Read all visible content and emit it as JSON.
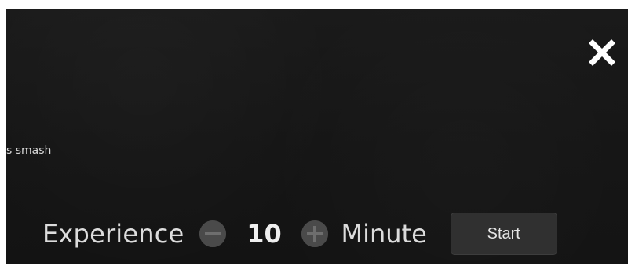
{
  "window": {
    "close_icon": "close-icon"
  },
  "game": {
    "title_fragment": "s smash"
  },
  "session": {
    "label": "Experience",
    "minutes": "10",
    "unit": "Minute",
    "decrement_icon": "minus-circle-icon",
    "increment_icon": "plus-circle-icon",
    "start_label": "Start"
  },
  "colors": {
    "background": "#151515",
    "text": "#dcdcdc",
    "stepper": "#4a4a4a",
    "button": "#303030"
  }
}
